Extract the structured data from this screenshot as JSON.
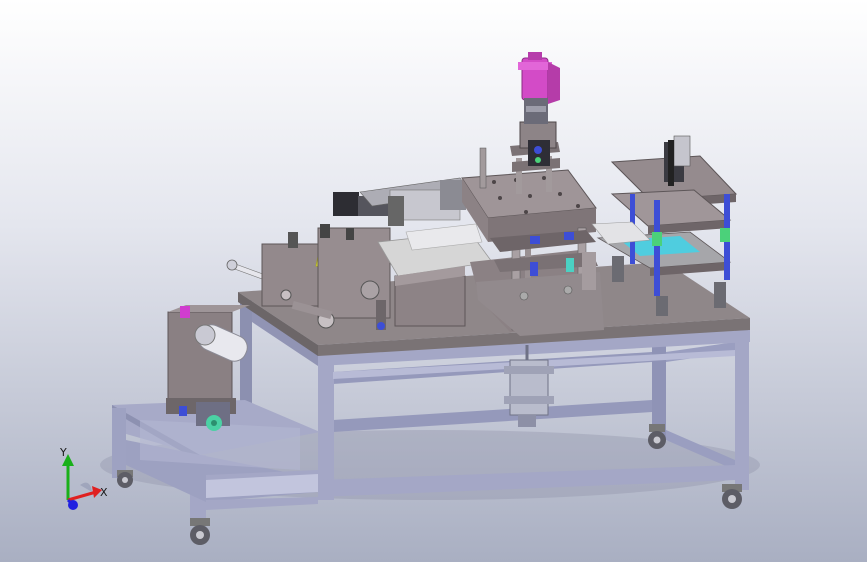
{
  "viewport": {
    "background_top": "#ffffff",
    "background_bottom": "#a9afc2"
  },
  "triad": {
    "y_label": "Y",
    "x_label": "X",
    "colors": {
      "x": "#e02020",
      "y": "#19b019",
      "z": "#2020e0"
    }
  },
  "model": {
    "colors": {
      "frame": "#a4a7c6",
      "frame_dark": "#7f83a6",
      "table_top": "#8f8789",
      "plates": "#9a9090",
      "motor": "#d34bc7",
      "glass": "#d6d6d6",
      "accent_yellow": "#e8e840",
      "accent_blue": "#3d4ed6",
      "accent_green": "#4bd17a",
      "accent_cyan": "#39d7ec"
    }
  }
}
